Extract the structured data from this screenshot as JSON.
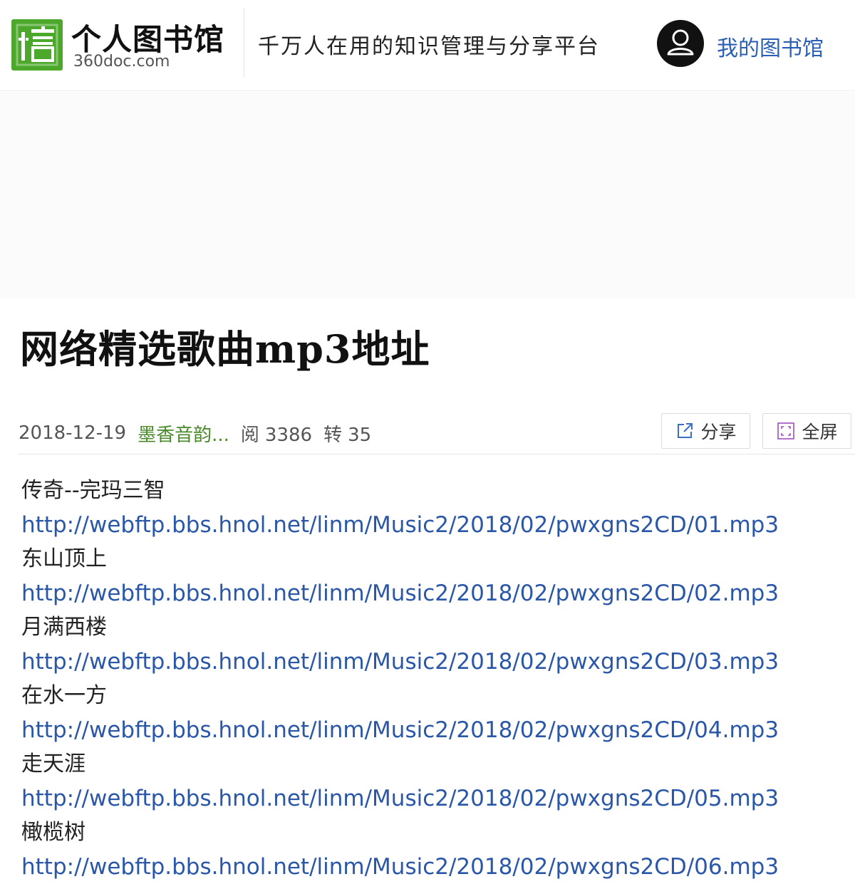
{
  "header": {
    "logo_icon": "library-logo-icon",
    "brand_name": "个人图书馆",
    "brand_domain": "360doc.com",
    "tagline": "千万人在用的知识管理与分享平台",
    "avatar_icon": "user-avatar-icon",
    "my_library_label": "我的图书馆"
  },
  "article": {
    "title": "网络精选歌曲mp3地址",
    "date": "2018-12-19",
    "author": "墨香音韵...",
    "reads_label": "阅",
    "reads_count": "3386",
    "reposts_label": "转",
    "reposts_count": "35",
    "share_label": "分享",
    "fullscreen_label": "全屏"
  },
  "songs": [
    {
      "name": "传奇--完玛三智",
      "url": "http://webftp.bbs.hnol.net/linm/Music2/2018/02/pwxgns2CD/01.mp3"
    },
    {
      "name": "东山顶上",
      "url": "http://webftp.bbs.hnol.net/linm/Music2/2018/02/pwxgns2CD/02.mp3"
    },
    {
      "name": "月满西楼",
      "url": "http://webftp.bbs.hnol.net/linm/Music2/2018/02/pwxgns2CD/03.mp3"
    },
    {
      "name": "在水一方",
      "url": "http://webftp.bbs.hnol.net/linm/Music2/2018/02/pwxgns2CD/04.mp3"
    },
    {
      "name": "走天涯",
      "url": "http://webftp.bbs.hnol.net/linm/Music2/2018/02/pwxgns2CD/05.mp3"
    },
    {
      "name": "橄榄树",
      "url": "http://webftp.bbs.hnol.net/linm/Music2/2018/02/pwxgns2CD/06.mp3"
    }
  ],
  "colors": {
    "brand_green": "#4ba82a",
    "link_blue": "#2a57a8",
    "nav_blue": "#2b5fb4",
    "author_green": "#4a8a2a"
  }
}
